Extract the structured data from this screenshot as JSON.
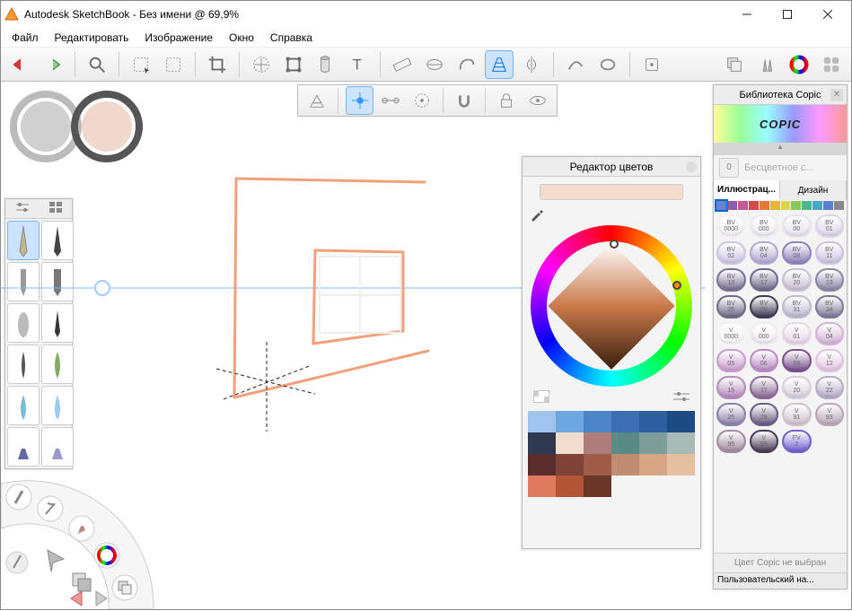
{
  "titlebar": {
    "app": "Autodesk SketchBook",
    "doc": "Без имени @ 69,9%"
  },
  "menu": {
    "file": "Файл",
    "edit": "Редактировать",
    "image": "Изображение",
    "window": "Окно",
    "help": "Справка"
  },
  "color_editor": {
    "title": "Редактор цветов"
  },
  "copic": {
    "title": "Библиотека Copic",
    "brand": "COPIC",
    "current_chip": "0",
    "current_name": "Бесцветное с...",
    "tab_illustration": "Иллюстрац...",
    "tab_design": "Дизайн",
    "status": "Цвет Copic не выбран",
    "user": "Пользовательский на...",
    "markers": [
      {
        "l": "BV",
        "n": "0000",
        "c": "#f4f1f6"
      },
      {
        "l": "BV",
        "n": "000",
        "c": "#efeaf3"
      },
      {
        "l": "BV",
        "n": "00",
        "c": "#e8e2f0"
      },
      {
        "l": "BV",
        "n": "01",
        "c": "#dcd4ea"
      },
      {
        "l": "BV",
        "n": "02",
        "c": "#d0c6e4"
      },
      {
        "l": "BV",
        "n": "04",
        "c": "#b3a8d4"
      },
      {
        "l": "BV",
        "n": "08",
        "c": "#8f82bd"
      },
      {
        "l": "BV",
        "n": "11",
        "c": "#cdc3e0"
      },
      {
        "l": "BV",
        "n": "13",
        "c": "#7b7096"
      },
      {
        "l": "BV",
        "n": "17",
        "c": "#6e6a8d"
      },
      {
        "l": "BV",
        "n": "20",
        "c": "#c9bfd4"
      },
      {
        "l": "BV",
        "n": "23",
        "c": "#8d86a6"
      },
      {
        "l": "BV",
        "n": "25",
        "c": "#6f6a88"
      },
      {
        "l": "BV",
        "n": "29",
        "c": "#3e3a54"
      },
      {
        "l": "BV",
        "n": "31",
        "c": "#bebad0"
      },
      {
        "l": "BV",
        "n": "34",
        "c": "#7e7a9a"
      },
      {
        "l": "V",
        "n": "0000",
        "c": "#f7f2f7"
      },
      {
        "l": "V",
        "n": "000",
        "c": "#f2e9f2"
      },
      {
        "l": "V",
        "n": "01",
        "c": "#e7d6e8"
      },
      {
        "l": "V",
        "n": "04",
        "c": "#d3b4d7"
      },
      {
        "l": "V",
        "n": "05",
        "c": "#c99dcf"
      },
      {
        "l": "V",
        "n": "06",
        "c": "#bb8bc5"
      },
      {
        "l": "V",
        "n": "09",
        "c": "#7a4f8e"
      },
      {
        "l": "V",
        "n": "12",
        "c": "#e2c6e1"
      },
      {
        "l": "V",
        "n": "15",
        "c": "#b68bbd"
      },
      {
        "l": "V",
        "n": "17",
        "c": "#8b6799"
      },
      {
        "l": "V",
        "n": "20",
        "c": "#d9cfdf"
      },
      {
        "l": "V",
        "n": "22",
        "c": "#b9abc9"
      },
      {
        "l": "V",
        "n": "25",
        "c": "#8f80aa"
      },
      {
        "l": "V",
        "n": "28",
        "c": "#6a5c86"
      },
      {
        "l": "V",
        "n": "91",
        "c": "#d0c2cd"
      },
      {
        "l": "V",
        "n": "93",
        "c": "#baa7b9"
      },
      {
        "l": "V",
        "n": "95",
        "c": "#a38ba3"
      },
      {
        "l": "V",
        "n": "99",
        "c": "#4a3a56"
      },
      {
        "l": "FV",
        "n": "2",
        "c": "#7060d0"
      },
      {
        "l": "",
        "n": "",
        "c": "#ffffff"
      }
    ]
  },
  "swatches": [
    "#9fc4ed",
    "#6ea7e1",
    "#4c86c6",
    "#3d6fb3",
    "#2d5f9e",
    "#1e4a84",
    "#2e384f",
    "#f1ddd0",
    "#ae7d7a",
    "#5a8a86",
    "#7d9d98",
    "#a7bab5",
    "#5a2d2d",
    "#7e4336",
    "#9e5c46",
    "#c08d70",
    "#d6a584",
    "#e5c0a0",
    "#e07a5e",
    "#b35436",
    "#6a3628"
  ],
  "hue_strip": [
    "#6a7fd0",
    "#8c5ea8",
    "#c25a9a",
    "#d44a4a",
    "#e27a3a",
    "#e6b83a",
    "#d6d84a",
    "#8bc85a",
    "#4ab88a",
    "#4aa6c8",
    "#5a7fd0",
    "#888"
  ]
}
